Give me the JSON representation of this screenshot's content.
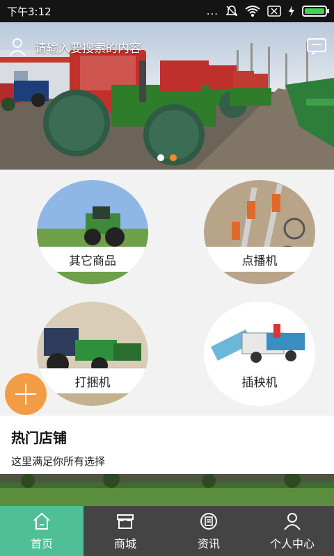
{
  "status_bar": {
    "time": "下午3:12",
    "dots": "..."
  },
  "banner": {
    "search_placeholder": "请输入要搜索的内容",
    "active_slide": 2,
    "slide_count": 2
  },
  "categories": [
    {
      "label": "其它商品"
    },
    {
      "label": "点播机"
    },
    {
      "label": "打捆机"
    },
    {
      "label": "插秧机"
    }
  ],
  "hot_stores": {
    "title": "热门店铺",
    "subtitle": "这里满足你所有选择"
  },
  "bottom_nav": [
    {
      "label": "首页",
      "active": true
    },
    {
      "label": "商城",
      "active": false
    },
    {
      "label": "资讯",
      "active": false
    },
    {
      "label": "个人中心",
      "active": false
    }
  ],
  "colors": {
    "accent_green": "#4fbf96",
    "accent_orange": "#f29d45",
    "nav_bg": "#444444"
  }
}
